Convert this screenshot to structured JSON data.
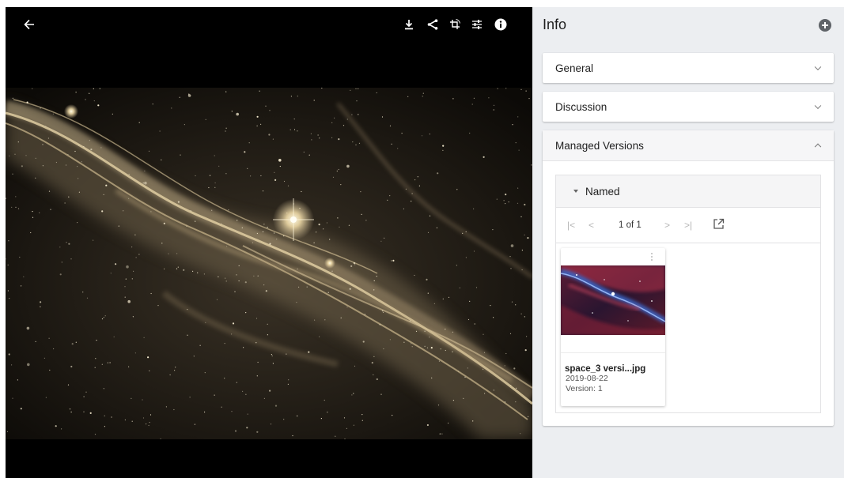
{
  "viewer": {
    "toolbar": {
      "back_icon": "arrow-left-icon",
      "download_icon": "download-icon",
      "share_icon": "share-icon",
      "crop_icon": "crop-rotate-icon",
      "adjust_icon": "sliders-icon",
      "info_icon": "info-circle-icon"
    },
    "image_tint": "#d8c49a"
  },
  "info": {
    "title": "Info",
    "sections": [
      {
        "label": "General",
        "expanded": false
      },
      {
        "label": "Discussion",
        "expanded": false
      },
      {
        "label": "Managed Versions",
        "expanded": true
      }
    ],
    "named": {
      "label": "Named",
      "pager": {
        "text": "1 of 1",
        "first": "|<",
        "prev": "<",
        "next": ">",
        "last": ">|"
      },
      "items": [
        {
          "name": "space_3 versi...jpg",
          "date": "2019-08-22",
          "version": "Version: 1"
        }
      ]
    }
  },
  "colors": {
    "panel_bg": "#eceef1",
    "viewer_bg": "#000000",
    "nebula_red": "#b8324a",
    "nebula_blue": "#3b6fd8"
  }
}
